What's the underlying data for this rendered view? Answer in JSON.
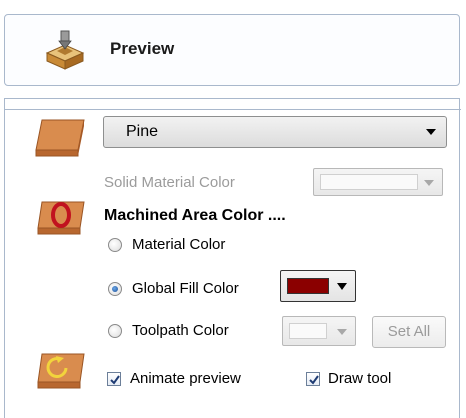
{
  "header": {
    "title": "Preview",
    "icon": "preview-cube-icon"
  },
  "material": {
    "icon": "material-block-icon",
    "selected": "Pine"
  },
  "solid_material_color": {
    "label": "Solid Material Color"
  },
  "machined_area": {
    "icon": "machined-area-icon",
    "title": "Machined Area Color ....",
    "swatch_color": "#8b0000"
  },
  "radios": {
    "material_color": "Material Color",
    "global_fill_color": "Global Fill Color",
    "toolpath_color": "Toolpath Color"
  },
  "set_all_label": "Set All",
  "animate": {
    "icon": "animate-tool-icon",
    "animate_label": "Animate preview",
    "draw_tool_label": "Draw tool"
  }
}
